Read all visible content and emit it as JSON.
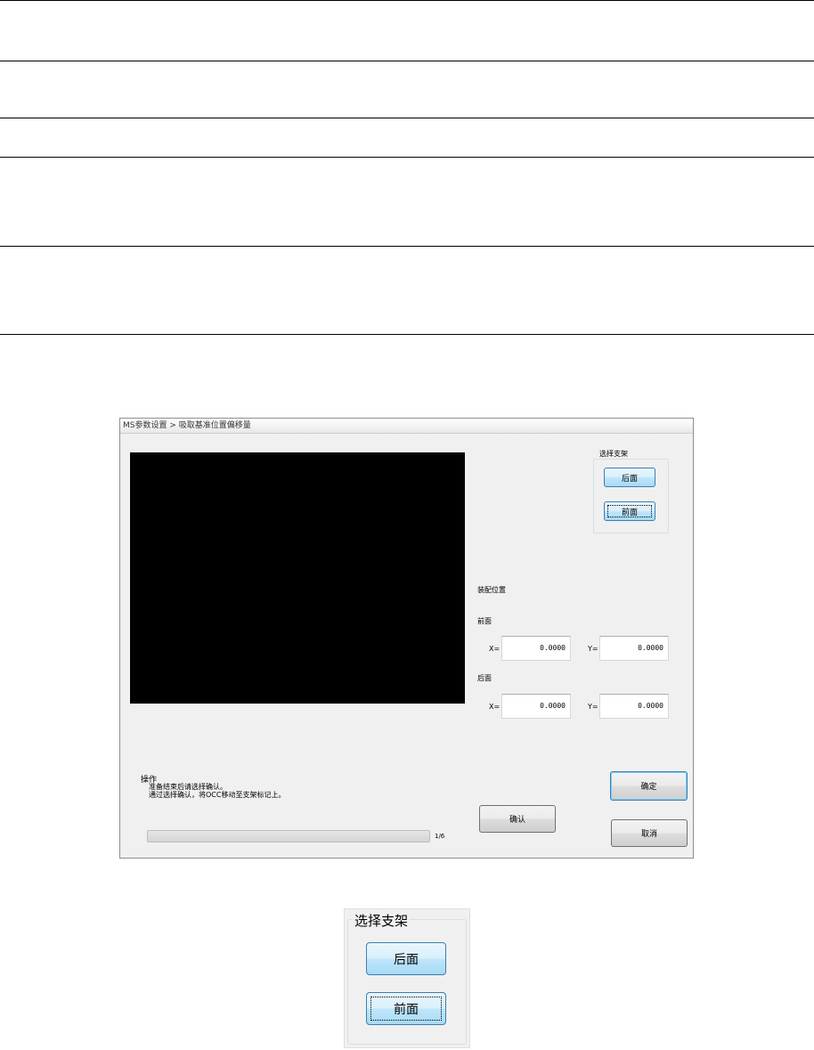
{
  "window": {
    "title": "MS参数设置 > 吸取基准位置偏移量"
  },
  "bracket_select": {
    "legend": "选择支架",
    "back_label": "后面",
    "front_label": "前面"
  },
  "mount_position": {
    "title": "装配位置",
    "front": {
      "label": "前面",
      "x_label": "X=",
      "x_value": "0.0000",
      "y_label": "Y=",
      "y_value": "0.0000"
    },
    "back": {
      "label": "后面",
      "x_label": "X=",
      "x_value": "0.0000",
      "y_label": "Y=",
      "y_value": "0.0000"
    }
  },
  "operation": {
    "title": "操作",
    "line1": "准备结束后请选择确认。",
    "line2": "通过选择确认，将OCC移动至支架标记上。",
    "confirm_label": "确认",
    "progress_text": "1/6",
    "progress_value": 0.0
  },
  "footer": {
    "ok_label": "确定",
    "cancel_label": "取消"
  },
  "zoom_inset": {
    "legend": "选择支架",
    "back_label": "后面",
    "front_label": "前面"
  }
}
